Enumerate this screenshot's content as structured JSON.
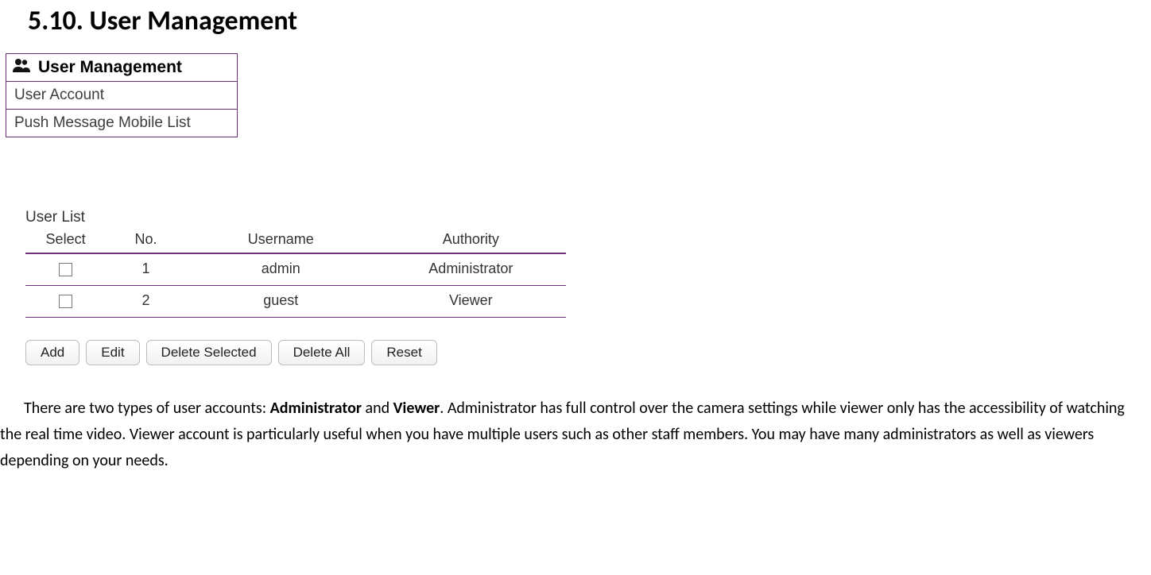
{
  "heading": "5.10.  User Management",
  "menu": {
    "title": "User Management",
    "items": [
      "User Account",
      "Push Message Mobile List"
    ]
  },
  "user_list": {
    "title": "User List",
    "columns": [
      "Select",
      "No.",
      "Username",
      "Authority"
    ],
    "rows": [
      {
        "no": "1",
        "username": "admin",
        "authority": "Administrator"
      },
      {
        "no": "2",
        "username": "guest",
        "authority": "Viewer"
      }
    ]
  },
  "buttons": {
    "add": "Add",
    "edit": "Edit",
    "delete_selected": "Delete Selected",
    "delete_all": "Delete All",
    "reset": "Reset"
  },
  "paragraph": {
    "p1a": "There are two types of user accounts: ",
    "bold1": "Administrator",
    "p1b": " and ",
    "bold2": "Viewer",
    "p1c": ". Administrator has full control over the camera settings while viewer only has the accessibility of watching the real time video. Viewer account is particularly useful when you have multiple users such as other staff members. You may have many administrators as well as viewers depending on your needs."
  }
}
